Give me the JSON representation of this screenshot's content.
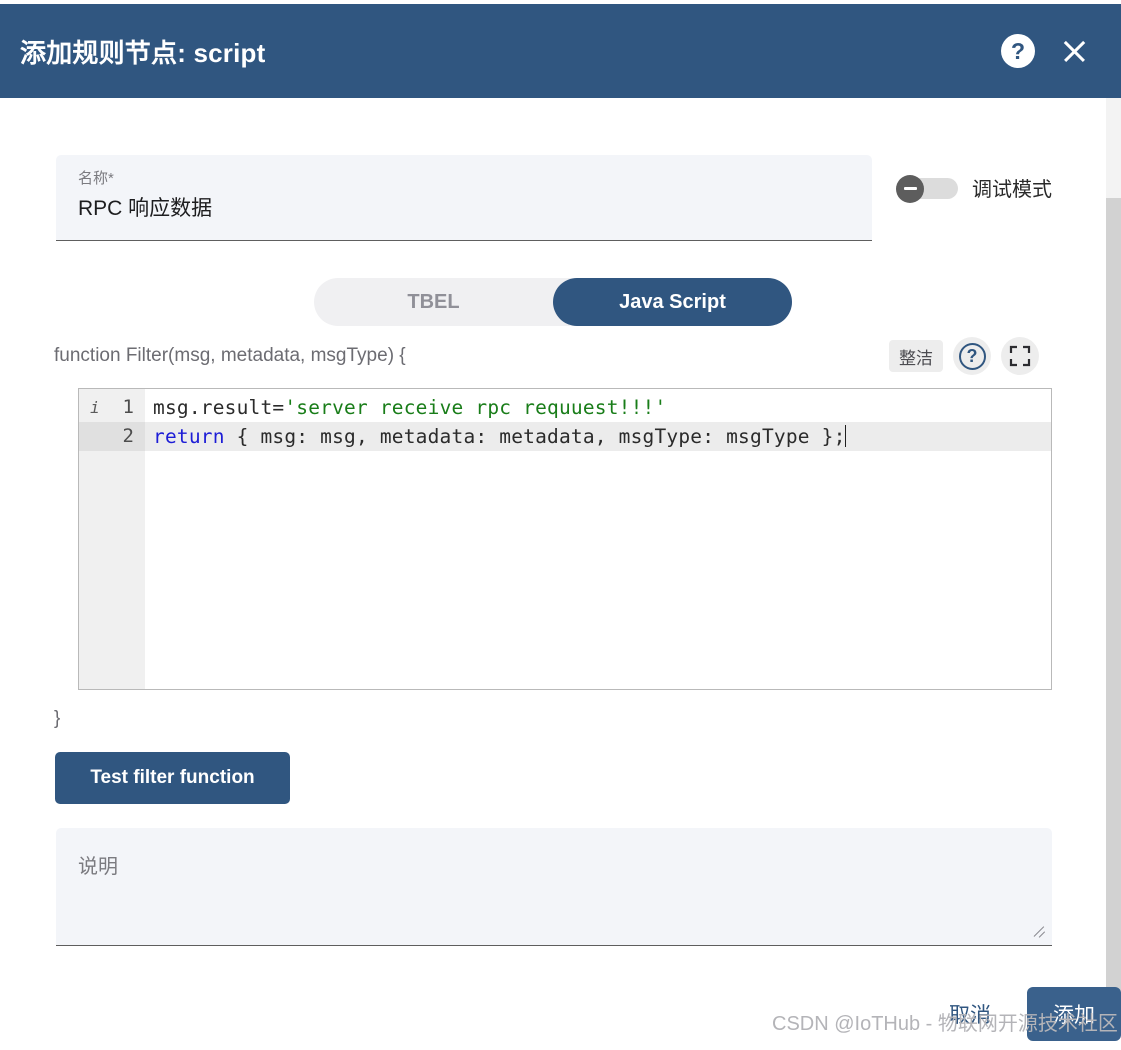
{
  "header": {
    "title": "添加规则节点: script",
    "help_icon": "question-mark-icon",
    "close_icon": "close-icon",
    "background_color": "#305680"
  },
  "name_field": {
    "label": "名称*",
    "value": "RPC 响应数据",
    "placeholder": "名称"
  },
  "debug_toggle": {
    "label": "调试模式",
    "state": "off"
  },
  "script_type_toggle": {
    "options": [
      {
        "label": "TBEL",
        "selected": false
      },
      {
        "label": "Java Script",
        "selected": true
      }
    ]
  },
  "editor": {
    "function_signature": "function Filter(msg, metadata, msgType) {",
    "closing_brace": "}",
    "toolbar": {
      "beautify_label": "整洁",
      "help_icon": "question-mark-icon",
      "fullscreen_icon": "fullscreen-icon"
    },
    "lines": [
      {
        "number": "1",
        "marker": "i",
        "active": false,
        "segments": [
          {
            "text": "msg.result=",
            "type": "plain"
          },
          {
            "text": "'server receive rpc requuest!!!'",
            "type": "string"
          }
        ]
      },
      {
        "number": "2",
        "marker": "",
        "active": true,
        "segments": [
          {
            "text": "return",
            "type": "keyword"
          },
          {
            "text": " { msg: msg, metadata: metadata, msgType: msgType };",
            "type": "plain"
          }
        ]
      }
    ],
    "code_plain": "msg.result='server receive rpc requuest!!!'\nreturn { msg: msg, metadata: metadata, msgType: msgType };"
  },
  "test_button": {
    "label": "Test filter function"
  },
  "description_field": {
    "placeholder": "说明",
    "value": ""
  },
  "footer": {
    "cancel_label": "取消",
    "add_label": "添加"
  },
  "watermark": {
    "text": "CSDN @IoTHub - 物联网开源技术社区"
  },
  "colors": {
    "primary": "#305680",
    "field_bg": "#f3f5f9",
    "string_green": "#197d19",
    "keyword_blue": "#1d1dd6"
  }
}
